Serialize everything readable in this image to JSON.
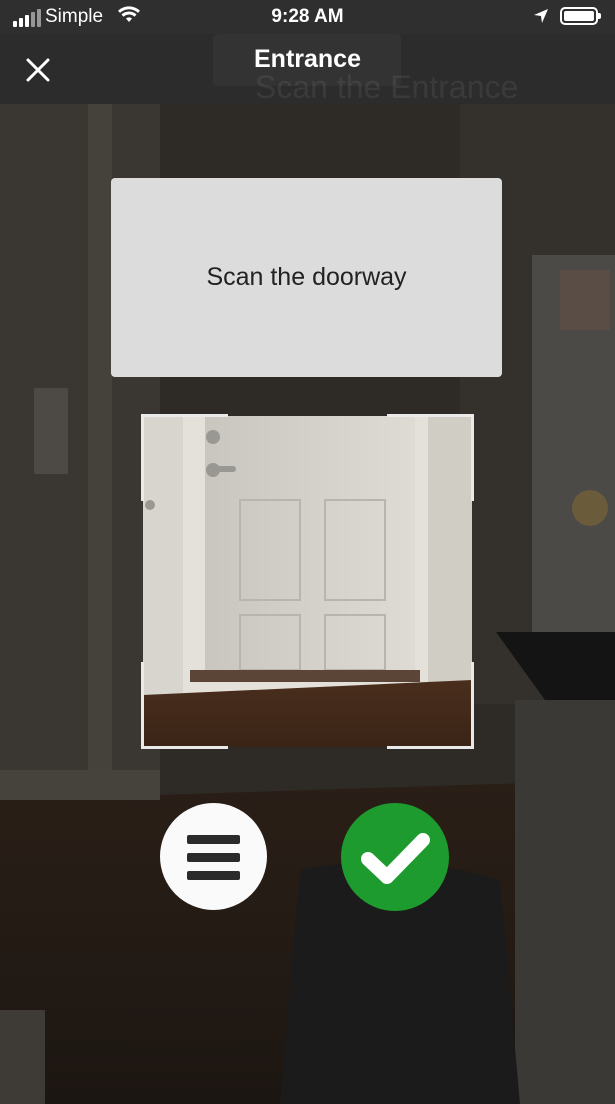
{
  "status_bar": {
    "carrier": "Simple",
    "time": "9:28 AM",
    "signal_icon": "signal-bars-icon",
    "wifi_icon": "wifi-icon",
    "location_icon": "location-arrow-icon",
    "battery_icon": "battery-icon"
  },
  "nav": {
    "title": "Entrance",
    "background_caption": "Scan the Entrance",
    "close_icon": "close-icon"
  },
  "instruction": {
    "text": "Scan the doorway"
  },
  "actions": {
    "menu_icon": "hamburger-menu-icon",
    "confirm_icon": "checkmark-icon",
    "confirm_color": "#1e9b2e"
  }
}
